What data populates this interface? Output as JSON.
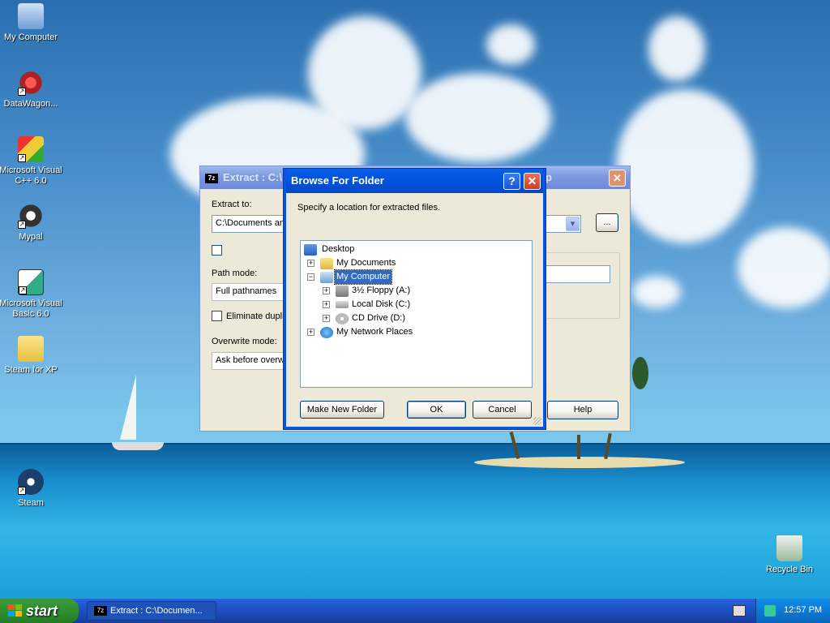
{
  "desktop": {
    "icons": [
      {
        "label": "My Computer",
        "icon": "my-computer-icon"
      },
      {
        "label": "DataWagon...",
        "icon": "datawagon-icon"
      },
      {
        "label": "Microsoft Visual C++ 6.0",
        "icon": "visual-cpp-icon"
      },
      {
        "label": "Mypal",
        "icon": "mypal-icon"
      },
      {
        "label": "Microsoft Visual Basic 6.0",
        "icon": "visual-basic-icon"
      },
      {
        "label": "Steam for XP",
        "icon": "folder-icon"
      },
      {
        "label": "Steam",
        "icon": "steam-icon"
      },
      {
        "label": "Recycle Bin",
        "icon": "recycle-bin-icon"
      }
    ]
  },
  "extract_window": {
    "title": "Extract : C:\\",
    "title_suffix": "p",
    "extract_to_label": "Extract to:",
    "extract_to_value": "C:\\Documents and",
    "browse_button": "...",
    "path_mode_label": "Path mode:",
    "path_mode_value": "Full pathnames",
    "eliminate_label": "Eliminate duplic",
    "overwrite_mode_label": "Overwrite mode:",
    "overwrite_mode_value": "Ask before overw",
    "help_button": "Help"
  },
  "browse_dialog": {
    "title": "Browse For Folder",
    "help_glyph": "?",
    "close_glyph": "✕",
    "instruction": "Specify a location for extracted files.",
    "tree": [
      {
        "label": "Desktop",
        "level": 0,
        "expander": "",
        "icon": "desktop-icon",
        "selected": false
      },
      {
        "label": "My Documents",
        "level": 1,
        "expander": "+",
        "icon": "my-documents-icon",
        "selected": false
      },
      {
        "label": "My Computer",
        "level": 1,
        "expander": "−",
        "icon": "my-computer-icon",
        "selected": true
      },
      {
        "label": "3½ Floppy (A:)",
        "level": 2,
        "expander": "+",
        "icon": "floppy-icon",
        "selected": false
      },
      {
        "label": "Local Disk (C:)",
        "level": 2,
        "expander": "+",
        "icon": "local-disk-icon",
        "selected": false
      },
      {
        "label": "CD Drive (D:)",
        "level": 2,
        "expander": "+",
        "icon": "cd-drive-icon",
        "selected": false
      },
      {
        "label": "My Network Places",
        "level": 1,
        "expander": "+",
        "icon": "network-places-icon",
        "selected": false
      }
    ],
    "make_new_folder_button": "Make New Folder",
    "ok_button": "OK",
    "cancel_button": "Cancel"
  },
  "taskbar": {
    "start_label": "start",
    "task_app_badge": "7z",
    "task_button_label": "Extract : C:\\Documen...",
    "clock": "12:57 PM"
  },
  "colors": {
    "xp_blue": "#0054e3",
    "selection": "#316ac5",
    "start_green": "#2f8f2f",
    "dialog_face": "#ece9d8"
  }
}
